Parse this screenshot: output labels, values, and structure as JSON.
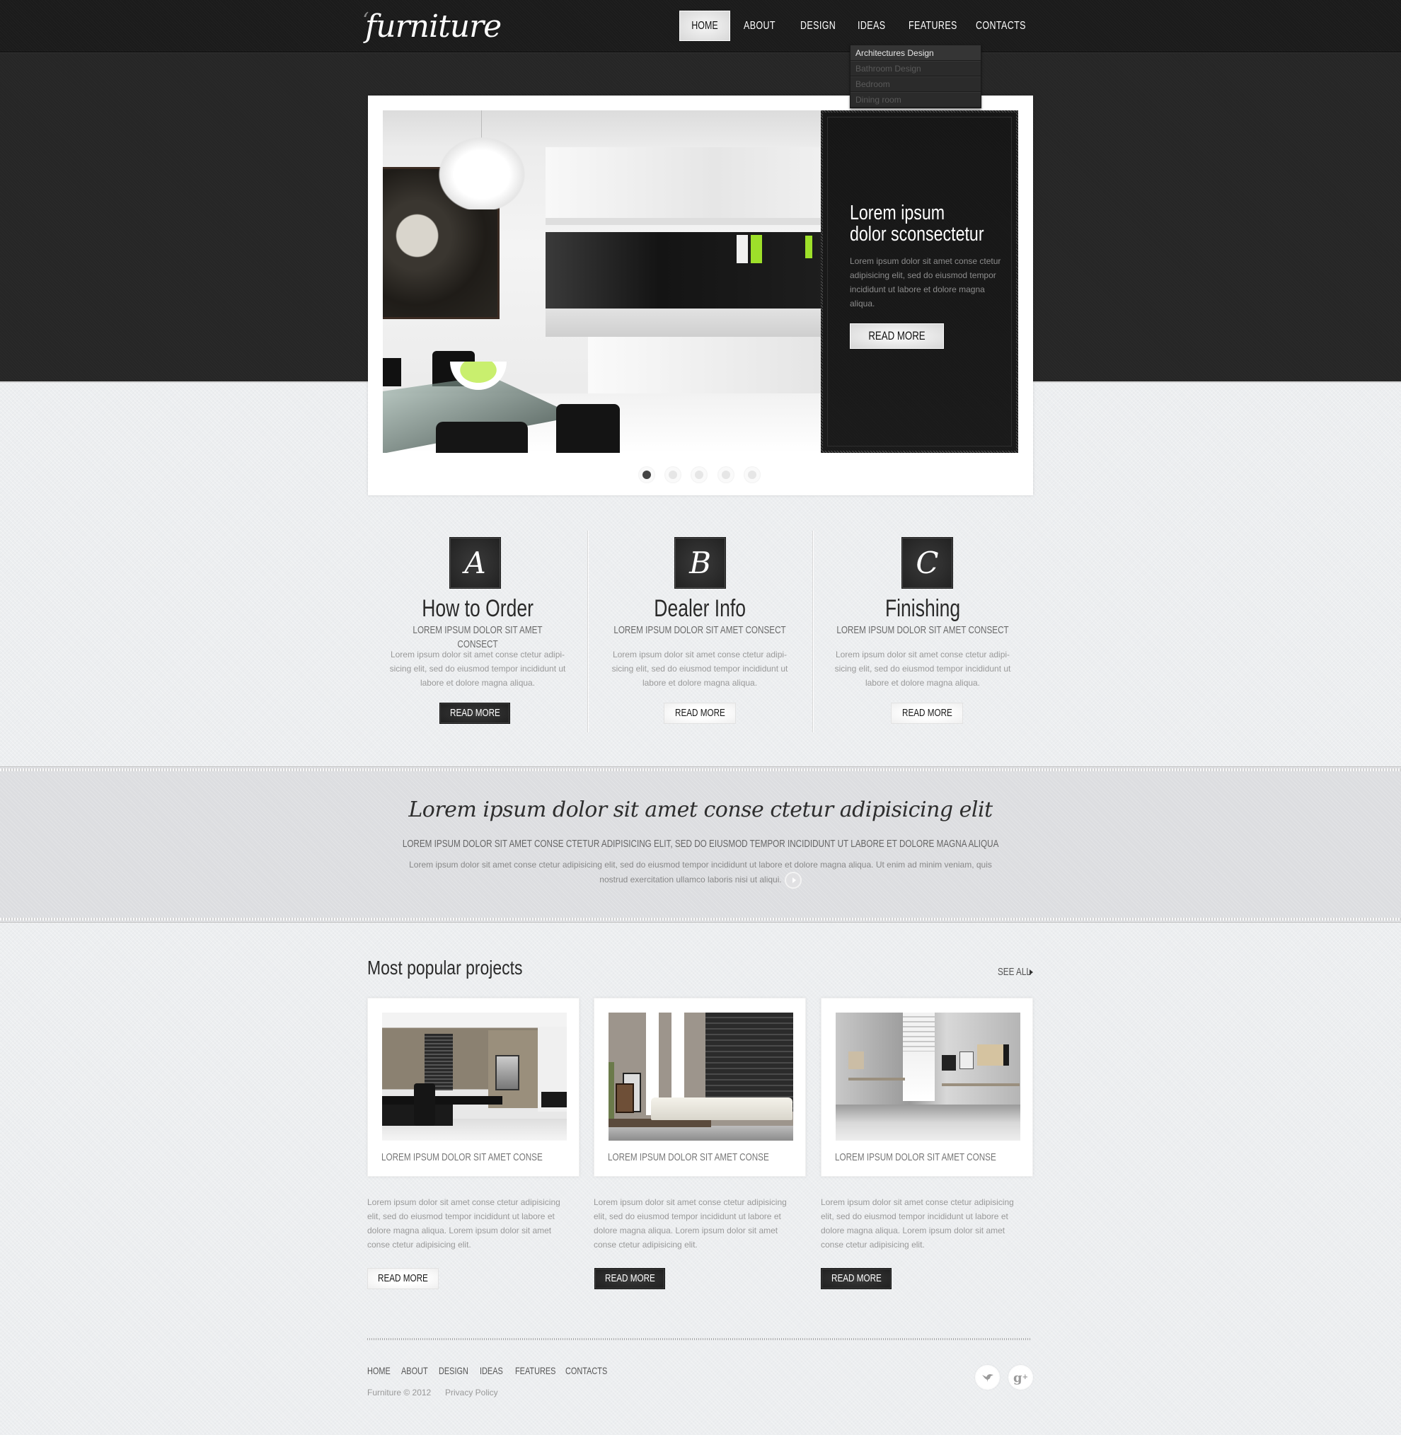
{
  "header": {
    "logo": "furniture",
    "nav": [
      {
        "label": "HOME",
        "active": true
      },
      {
        "label": "ABOUT"
      },
      {
        "label": "DESIGN"
      },
      {
        "label": "IDEAS"
      },
      {
        "label": "FEATURES"
      },
      {
        "label": "CONTACTS"
      }
    ],
    "dropdown": [
      {
        "label": "Architectures Design",
        "active": true
      },
      {
        "label": "Bathroom Design"
      },
      {
        "label": "Bedroom"
      },
      {
        "label": "Dining room"
      }
    ]
  },
  "slider": {
    "title_line1": "Lorem ipsum",
    "title_line2": "dolor sconsectetur",
    "text": "Lorem ipsum dolor sit amet conse ctetur adipisicing elit, sed do eiusmod tempor incididunt ut labore et dolore magna aliqua.",
    "button": "READ MORE",
    "dots_total": 5,
    "active_dot": 1
  },
  "features": [
    {
      "letter": "A",
      "title": "How to Order",
      "subtitle": "LOREM IPSUM DOLOR SIT AMET CONSECT",
      "text": "Lorem ipsum dolor sit amet conse ctetur adipi-sicing elit, sed do eiusmod tempor incididunt ut labore et dolore magna aliqua.",
      "button": "READ MORE",
      "button_style": "dark"
    },
    {
      "letter": "B",
      "title": "Dealer Info",
      "subtitle": "LOREM IPSUM DOLOR SIT AMET CONSECT",
      "text": "Lorem ipsum dolor sit amet conse ctetur adipi-sicing elit, sed do eiusmod tempor incididunt ut labore et dolore magna aliqua.",
      "button": "READ MORE",
      "button_style": "light"
    },
    {
      "letter": "C",
      "title": "Finishing",
      "subtitle": "LOREM IPSUM DOLOR SIT AMET CONSECT",
      "text": "Lorem ipsum dolor sit amet conse ctetur adipi-sicing elit, sed do eiusmod tempor incididunt ut labore et dolore magna aliqua.",
      "button": "READ MORE",
      "button_style": "light"
    }
  ],
  "quote": {
    "title": "Lorem ipsum dolor sit amet conse ctetur adipisicing elit",
    "subtitle": "LOREM IPSUM DOLOR SIT AMET CONSE CTETUR ADIPISICING ELIT, SED DO EIUSMOD TEMPOR INCIDIDUNT UT LABORE ET DOLORE MAGNA ALIQUA",
    "text": "Lorem ipsum dolor sit amet conse ctetur adipisicing elit, sed do eiusmod tempor incididunt ut labore et dolore magna aliqua. Ut enim ad minim veniam, quis nostrud exercitation ullamco laboris nisi ut aliqui."
  },
  "projects": {
    "title": "Most popular projects",
    "see_all": "SEE ALL",
    "items": [
      {
        "caption": "LOREM IPSUM DOLOR SIT AMET CONSE",
        "text": "Lorem ipsum dolor sit amet conse ctetur adipisicing elit, sed do eiusmod tempor incididunt ut labore et dolore magna aliqua. Lorem ipsum dolor sit amet conse ctetur adipisicing elit.",
        "button": "READ MORE",
        "button_style": "light",
        "image": "office-interior"
      },
      {
        "caption": "LOREM IPSUM DOLOR SIT AMET CONSE",
        "text": "Lorem ipsum dolor sit amet conse ctetur adipisicing elit, sed do eiusmod tempor incididunt ut labore et dolore magna aliqua. Lorem ipsum dolor sit amet conse ctetur adipisicing elit.",
        "button": "READ MORE",
        "button_style": "dark",
        "image": "living-room-interior"
      },
      {
        "caption": "LOREM IPSUM DOLOR SIT AMET CONSE",
        "text": "Lorem ipsum dolor sit amet conse ctetur adipisicing elit, sed do eiusmod tempor incididunt ut labore et dolore magna aliqua. Lorem ipsum dolor sit amet conse ctetur adipisicing elit.",
        "button": "READ MORE",
        "button_style": "dark",
        "image": "study-room-interior"
      }
    ]
  },
  "footer": {
    "nav": [
      "HOME",
      "ABOUT",
      "DESIGN",
      "IDEAS",
      "FEATURES",
      "CONTACTS"
    ],
    "copyright": "Furniture © 2012",
    "privacy": "Privacy Policy",
    "social": [
      {
        "icon": "twitter-icon",
        "glyph": "🐦"
      },
      {
        "icon": "google-plus-icon",
        "glyph": "g+"
      }
    ]
  },
  "colors": {
    "dark_band": "#262626",
    "header": "#1b1b1b",
    "page_bg": "#eceef0",
    "quote_band": "#dcdde0",
    "accent_green": "#9ee02a"
  }
}
